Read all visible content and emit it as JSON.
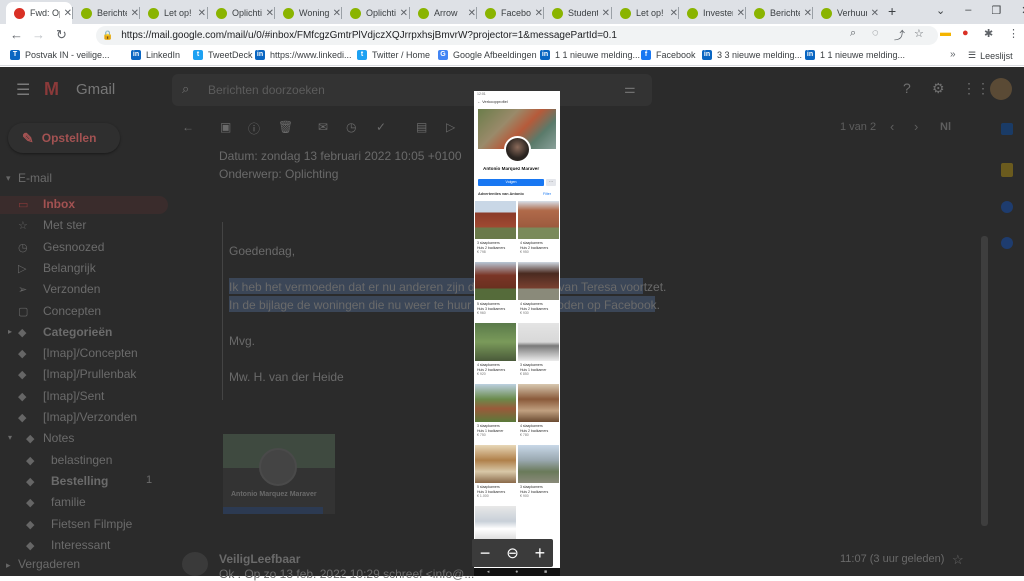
{
  "browser": {
    "tabs": [
      {
        "title": "Fwd: Oplichting",
        "color": "#d93025"
      },
      {
        "title": "Berichten",
        "color": "#8ab400"
      },
      {
        "title": "Let op!",
        "color": "#8ab400"
      },
      {
        "title": "Oplichting",
        "color": "#8ab400"
      },
      {
        "title": "Woningen",
        "color": "#8ab400"
      },
      {
        "title": "Oplichting",
        "color": "#8ab400"
      },
      {
        "title": "Arrow",
        "color": "#8ab400"
      },
      {
        "title": "Facebook",
        "color": "#8ab400"
      },
      {
        "title": "Studenten",
        "color": "#8ab400"
      },
      {
        "title": "Let op!",
        "color": "#8ab400"
      },
      {
        "title": "Investeren",
        "color": "#8ab400"
      },
      {
        "title": "Berichten",
        "color": "#8ab400"
      },
      {
        "title": "Verhuur",
        "color": "#8ab400"
      }
    ],
    "url": "https://mail.google.com/mail/u/0/#inbox/FMfcgzGmtrPlVdjczXQJrrpxhsjBmvrW?projector=1&messagePartId=0.1",
    "bookmarks": [
      {
        "label": "Postvak IN - veilige...",
        "icon": "T",
        "color": "#0a66c2"
      },
      {
        "label": "LinkedIn",
        "icon": "in",
        "color": "#0a66c2"
      },
      {
        "label": "TweetDeck",
        "icon": "t",
        "color": "#1da1f2"
      },
      {
        "label": "https://www.linkedi...",
        "icon": "in",
        "color": "#0a66c2"
      },
      {
        "label": "Twitter / Home",
        "icon": "t",
        "color": "#1da1f2"
      },
      {
        "label": "Google Afbeeldingen",
        "icon": "G",
        "color": "#4285f4"
      },
      {
        "label": "1 1 nieuwe melding...",
        "icon": "in",
        "color": "#0a66c2"
      },
      {
        "label": "Facebook",
        "icon": "f",
        "color": "#1877f2"
      },
      {
        "label": "3 3 nieuwe melding...",
        "icon": "in",
        "color": "#0a66c2"
      },
      {
        "label": "1 1 nieuwe melding...",
        "icon": "in",
        "color": "#0a66c2"
      }
    ],
    "reading_list": "Leeslijst"
  },
  "gmail": {
    "logo_text": "Gmail",
    "search_placeholder": "Berichten doorzoeken",
    "compose_label": "Opstellen",
    "section_email": "E-mail",
    "sidebar": [
      {
        "label": "Inbox",
        "bold": true,
        "active": true,
        "icon": "inbox-icon",
        "glyph": "▭"
      },
      {
        "label": "Met ster",
        "icon": "star-icon",
        "glyph": "☆"
      },
      {
        "label": "Gesnoozed",
        "icon": "clock-icon",
        "glyph": "◷"
      },
      {
        "label": "Belangrijk",
        "icon": "important-icon",
        "glyph": "▷"
      },
      {
        "label": "Verzonden",
        "icon": "send-icon",
        "glyph": "➢"
      },
      {
        "label": "Concepten",
        "icon": "draft-icon",
        "glyph": "▢"
      },
      {
        "label": "Categorieën",
        "bold": true,
        "icon": "label-icon",
        "glyph": "◆"
      },
      {
        "label": "[Imap]/Concepten",
        "icon": "label-icon",
        "glyph": "◆"
      },
      {
        "label": "[Imap]/Prullenbak",
        "icon": "label-icon",
        "glyph": "◆"
      },
      {
        "label": "[Imap]/Sent",
        "icon": "label-icon",
        "glyph": "◆"
      },
      {
        "label": "[Imap]/Verzonden",
        "icon": "label-icon",
        "glyph": "◆"
      },
      {
        "label": "Notes",
        "icon": "label-icon",
        "glyph": "◆"
      },
      {
        "label": "belastingen",
        "icon": "label-icon",
        "glyph": "◆"
      },
      {
        "label": "Bestelling",
        "bold": true,
        "icon": "label-icon",
        "glyph": "◆",
        "count": "1"
      },
      {
        "label": "familie",
        "icon": "label-icon",
        "glyph": "◆"
      },
      {
        "label": "Fietsen Filmpje",
        "icon": "label-icon",
        "glyph": "◆"
      },
      {
        "label": "Interessant",
        "icon": "label-icon",
        "glyph": "◆"
      }
    ],
    "section_meetings": "Vergaderen",
    "pagination": "1 van 2",
    "lang": "Nl",
    "email": {
      "date_line": "Datum: zondag 13 februari 2022 10:05 +0100",
      "subject_line": "Onderwerp: Oplichting",
      "greeting": "Goedendag,",
      "line1": "Ik heb het vermoeden dat er nu anderen zijn die de praktijken van Teresa voortzet.",
      "line2": "In de bijlage de woningen die nu weer te huur worden aangeboden op Facebook.",
      "signoff": "Mvg.",
      "signature": "Mw. H. van der Heide",
      "attachment_name": "Antonio Marquez Maraver"
    },
    "reply": {
      "sender": "VeiligLeefbaar",
      "preview": "Ok . Op zo 13 feb. 2022 10:29 schreef <info@...",
      "time": "11:07 (3 uur geleden)"
    }
  },
  "attachment_preview": {
    "status": "12:01",
    "header": "← Verkoopprofiel",
    "name": "Antonio Marquez Maraver",
    "follow_button": "Volgen",
    "section": "Advertenties van Antonio",
    "filter": "Filter",
    "listings": [
      {
        "line1": "3 slaapkamers",
        "line2": "Huis 2 badkamers",
        "price": "€ 798"
      },
      {
        "line1": "4 slaapkamers",
        "line2": "Huis 2 badkamers",
        "price": "€ 950"
      },
      {
        "line1": "5 slaapkamers",
        "line2": "Huis 3 badkamers",
        "price": "€ 960"
      },
      {
        "line1": "4 slaapkamers",
        "line2": "Huis 2 badkamers",
        "price": "€ 930"
      },
      {
        "line1": "4 slaapkamers",
        "line2": "Huis 2 badkamers",
        "price": "€ 920"
      },
      {
        "line1": "3 slaapkamers",
        "line2": "Huis 1 badkamer",
        "price": "€ 850"
      },
      {
        "line1": "3 slaapkamers",
        "line2": "Huis 1 badkamer",
        "price": "€ 750"
      },
      {
        "line1": "4 slaapkamers",
        "line2": "Huis 2 badkamers",
        "price": "€ 780"
      },
      {
        "line1": "5 slaapkamers",
        "line2": "Huis 3 badkamers",
        "price": "€ 1.000"
      },
      {
        "line1": "3 slaapkamers",
        "line2": "Huis 2 badkamers",
        "price": "€ 900"
      },
      {
        "line1": "",
        "line2": "",
        "price": ""
      }
    ],
    "zoom": {
      "minus": "−",
      "zoom_icon": "⊖",
      "plus": "+"
    }
  }
}
